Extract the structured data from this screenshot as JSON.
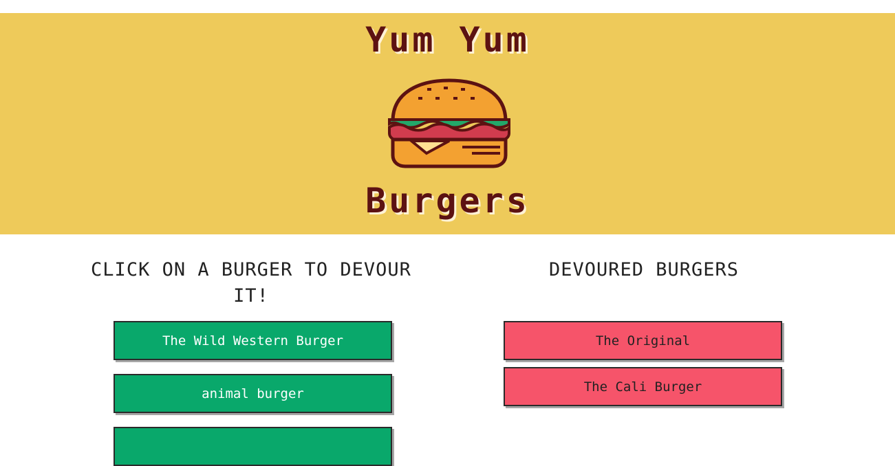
{
  "header": {
    "title_top": "Yum Yum",
    "title_bottom": "Burgers",
    "logo_icon": "burger-icon"
  },
  "left_column": {
    "heading": "CLICK ON A BURGER TO DEVOUR IT!",
    "burgers": [
      {
        "name": "The Wild Western Burger"
      },
      {
        "name": "animal burger"
      },
      {
        "name": ""
      }
    ]
  },
  "right_column": {
    "heading": "DEVOURED BURGERS",
    "burgers": [
      {
        "name": "The Original"
      },
      {
        "name": "The Cali Burger"
      }
    ]
  },
  "colors": {
    "hero_background": "#eeca5a",
    "title": "#5c1212",
    "uneaten_button": "#09a86b",
    "devoured_button": "#f6546a"
  }
}
